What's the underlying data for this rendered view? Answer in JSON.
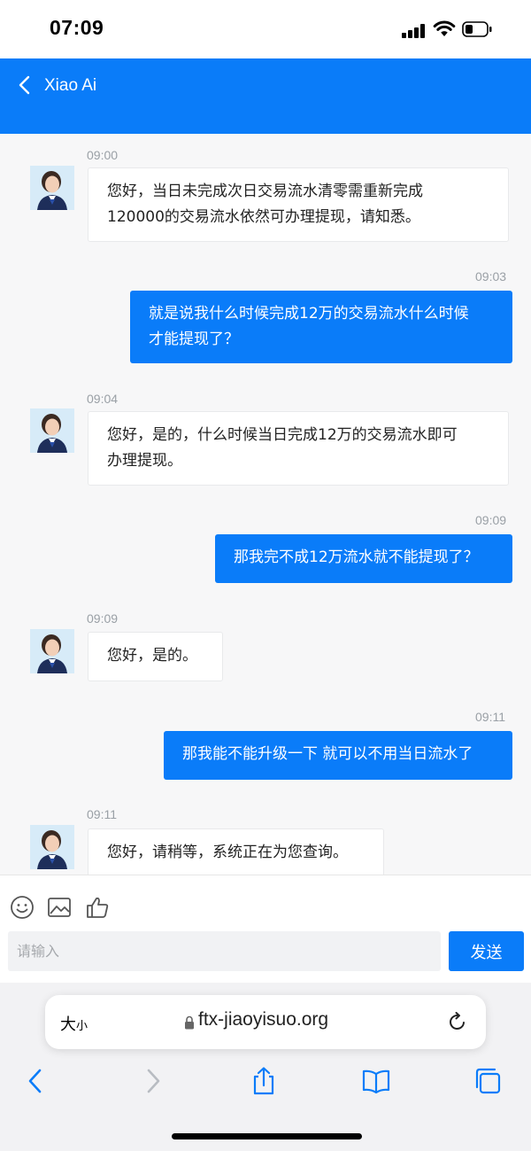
{
  "status_bar": {
    "time": "07:09"
  },
  "nav": {
    "title": "Xiao Ai"
  },
  "messages": [
    {
      "time": "09:00",
      "side": "in",
      "line1": "您好，当日未完成次日交易流水清零需重新完成",
      "line2": "120000的交易流水依然可办理提现，请知悉。"
    },
    {
      "time": "09:03",
      "side": "out",
      "line1": "就是说我什么时候完成12万的交易流水什么时候",
      "line2": "才能提现了？"
    },
    {
      "time": "09:04",
      "side": "in",
      "line1": "您好，是的，什么时候当日完成12万的交易流水即可",
      "line2": "办理提现。"
    },
    {
      "time": "09:09",
      "side": "out",
      "line1": "那我完不成12万流水就不能提现了？"
    },
    {
      "time": "09:09",
      "side": "in",
      "line1": "您好，是的。"
    },
    {
      "time": "09:11",
      "side": "out",
      "line1": "那我能不能升级一下 就可以不用当日流水了"
    },
    {
      "time": "09:11",
      "side": "in",
      "line1": "您好，请稍等，系统正在为您查询。"
    }
  ],
  "composer": {
    "placeholder": "请输入",
    "value": "",
    "send_label": "发送"
  },
  "browser": {
    "text_size_big": "大",
    "text_size_small": "小",
    "url": "ftx-jiaoyisuo.org"
  },
  "colors": {
    "accent": "#0a7cf9",
    "chat_bg": "#f7f7f8",
    "bubble_in": "#ffffff"
  }
}
